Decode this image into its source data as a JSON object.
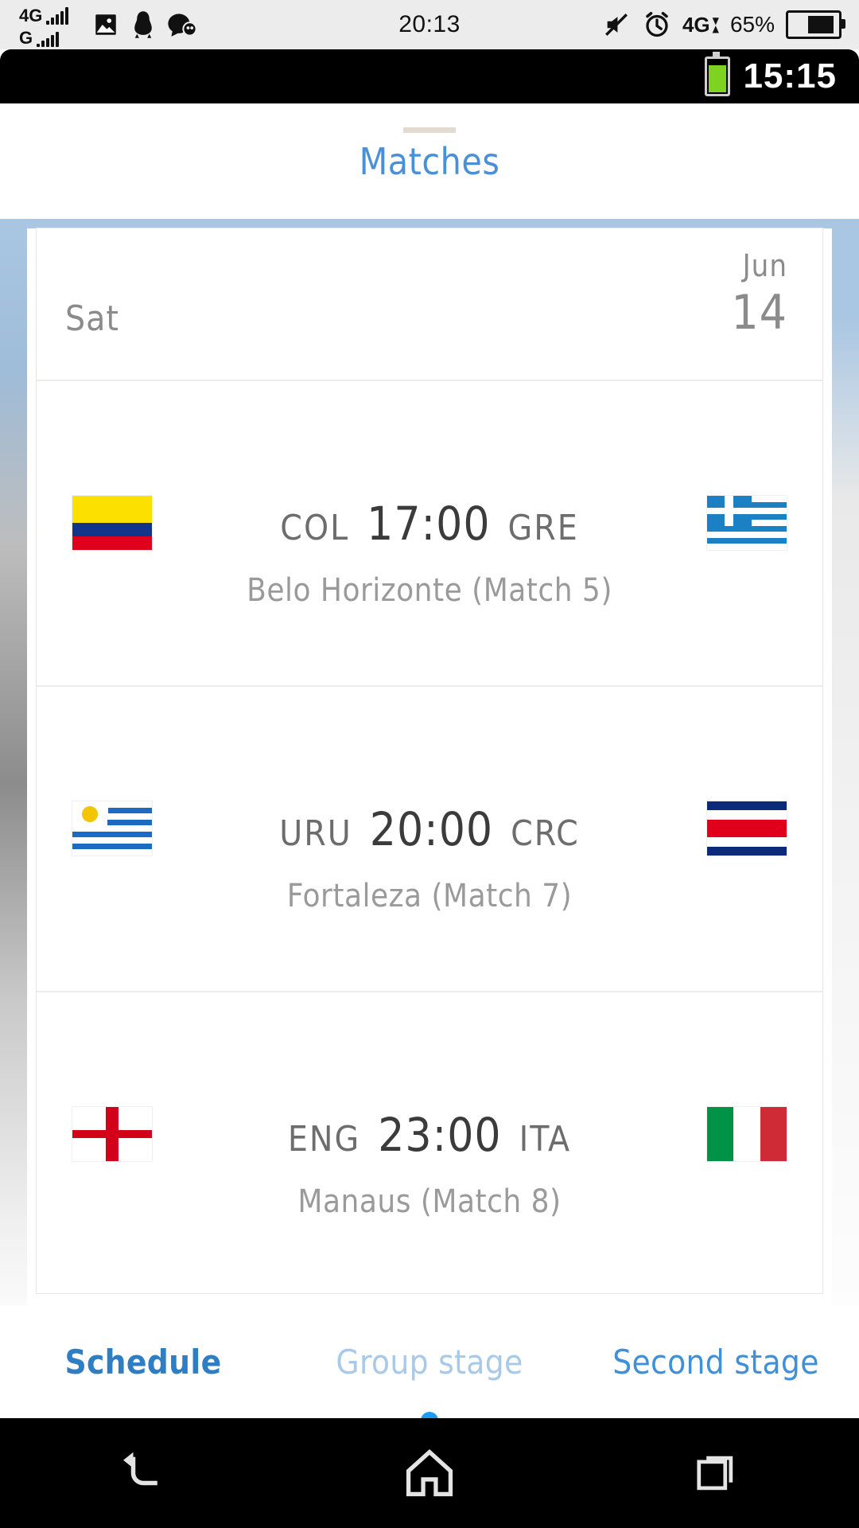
{
  "device_status": {
    "net_primary": "4G",
    "net_secondary": "G",
    "time": "20:13",
    "data_type": "4G",
    "battery_percent": "65%",
    "icons": [
      "photo-icon",
      "penguin-icon",
      "chat-icon",
      "mute-icon",
      "alarm-icon",
      "data-transfer-icon",
      "battery-icon"
    ]
  },
  "inner_status": {
    "time": "15:15",
    "battery": "battery-icon"
  },
  "app": {
    "title": "Matches"
  },
  "schedule": {
    "date": {
      "weekday": "Sat",
      "month": "Jun",
      "day": "14"
    },
    "matches": [
      {
        "home": "COL",
        "away": "GRE",
        "time": "17:00",
        "venue": "Belo Horizonte (Match  5)",
        "home_flag": "colombia-flag",
        "away_flag": "greece-flag"
      },
      {
        "home": "URU",
        "away": "CRC",
        "time": "20:00",
        "venue": "Fortaleza (Match  7)",
        "home_flag": "uruguay-flag",
        "away_flag": "costa-rica-flag"
      },
      {
        "home": "ENG",
        "away": "ITA",
        "time": "23:00",
        "venue": "Manaus (Match  8)",
        "home_flag": "england-flag",
        "away_flag": "italy-flag"
      }
    ]
  },
  "tabs": [
    {
      "label": "Schedule",
      "state": "active"
    },
    {
      "label": "Group stage",
      "state": "muted"
    },
    {
      "label": "Second stage",
      "state": "normal"
    }
  ],
  "navbar": {
    "back": "back-icon",
    "home": "home-icon",
    "recents": "recents-icon"
  },
  "colors": {
    "accent_blue": "#2f7ec4",
    "title_blue": "#4a90d9",
    "frame_blue": "#a9c6e2",
    "dot_blue": "#1f9bf0",
    "battery_green": "#7ed321"
  }
}
